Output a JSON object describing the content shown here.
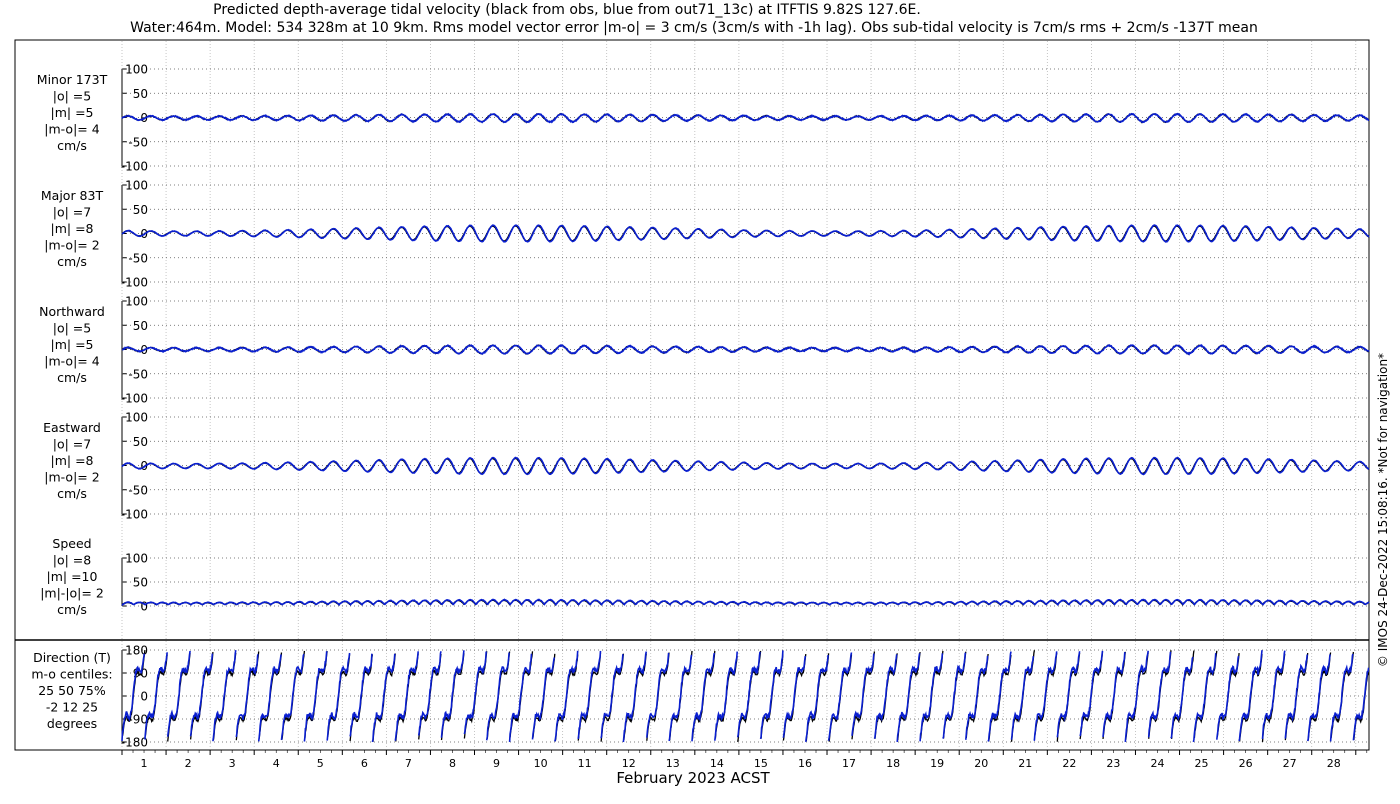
{
  "title_line1": "Predicted depth-average tidal velocity (black from obs, blue from out71_13c) at ITFTIS 9.82S 127.6E.",
  "title_line2": "Water:464m. Model: 534 328m at 10 9km. Rms model vector error |m-o| = 3 cm/s (3cm/s with -1h lag). Obs sub-tidal velocity is 7cm/s rms + 2cm/s -137T mean",
  "copyright_text": "© IMOS 24-Dec-2022 15:08:16.  *Not for navigation*",
  "colors": {
    "obs": "#000000",
    "model": "#0a1fd0",
    "grid": "#888888",
    "axis": "#000000"
  },
  "chart_data": {
    "type": "line",
    "xlabel": "February 2023 ACST",
    "x_ticks": [
      "1",
      "2",
      "3",
      "4",
      "5",
      "6",
      "7",
      "8",
      "9",
      "10",
      "11",
      "12",
      "13",
      "14",
      "15",
      "16",
      "17",
      "18",
      "19",
      "20",
      "21",
      "22",
      "23",
      "24",
      "25",
      "26",
      "27",
      "28"
    ],
    "xlim_days": [
      0.0,
      28.3
    ],
    "series": [
      {
        "name": "obs"
      },
      {
        "name": "model"
      }
    ],
    "panels": [
      {
        "id": "minor",
        "label_lines": [
          "Minor 173T",
          "|o| =5",
          "|m| =5",
          "|m-o|= 4",
          "cm/s"
        ],
        "ylim": [
          -100,
          100
        ],
        "y_ticks": [
          "100",
          "50",
          "0",
          "-50",
          "-100"
        ],
        "y_tick_values": [
          100,
          50,
          0,
          -50,
          -100
        ],
        "signal": {
          "kind": "tide",
          "amp_obs": 6,
          "amp_model": 6,
          "mod_depth": 0.35,
          "bias": -1,
          "noise": 2
        }
      },
      {
        "id": "major",
        "label_lines": [
          "Major 83T",
          "|o| =7",
          "|m| =8",
          "|m-o|= 2",
          "cm/s"
        ],
        "ylim": [
          -100,
          100
        ],
        "y_ticks": [
          "100",
          "50",
          "0",
          "-50",
          "-100"
        ],
        "y_tick_values": [
          100,
          50,
          0,
          -50,
          -100
        ],
        "signal": {
          "kind": "tide",
          "amp_obs": 10,
          "amp_model": 11,
          "mod_depth": 0.55,
          "bias": 0,
          "noise": 1
        }
      },
      {
        "id": "northward",
        "label_lines": [
          "Northward",
          "|o| =5",
          "|m| =5",
          "|m-o|= 4",
          "cm/s"
        ],
        "ylim": [
          -100,
          100
        ],
        "y_ticks": [
          "100",
          "50",
          "0",
          "-50",
          "-100"
        ],
        "y_tick_values": [
          100,
          50,
          0,
          -50,
          -100
        ],
        "signal": {
          "kind": "tide",
          "amp_obs": 6,
          "amp_model": 6,
          "mod_depth": 0.4,
          "bias": 0,
          "noise": 2
        }
      },
      {
        "id": "eastward",
        "label_lines": [
          "Eastward",
          "|o| =7",
          "|m| =8",
          "|m-o|= 2",
          "cm/s"
        ],
        "ylim": [
          -100,
          100
        ],
        "y_ticks": [
          "100",
          "50",
          "0",
          "-50",
          "-100"
        ],
        "y_tick_values": [
          100,
          50,
          0,
          -50,
          -100
        ],
        "signal": {
          "kind": "tide",
          "amp_obs": 10,
          "amp_model": 11,
          "mod_depth": 0.55,
          "bias": -1,
          "noise": 1
        }
      },
      {
        "id": "speed",
        "label_lines": [
          "Speed",
          "|o| =8",
          "|m| =10",
          "|m|-|o|= 2",
          "cm/s"
        ],
        "ylim": [
          0,
          100
        ],
        "y_ticks": [
          "100",
          "50",
          "0"
        ],
        "y_tick_values": [
          100,
          50,
          0
        ],
        "signal": {
          "kind": "speed",
          "amp_obs": 8,
          "amp_model": 9,
          "mod_depth": 0.4,
          "bias": 0,
          "noise": 1
        }
      },
      {
        "id": "direction",
        "label_lines": [
          "Direction (T)",
          "m-o centiles:",
          "25  50  75%",
          "-2  12  25",
          "degrees"
        ],
        "ylim": [
          -180,
          180
        ],
        "y_ticks": [
          "180",
          "90",
          "0",
          "-90",
          "-180"
        ],
        "y_tick_values": [
          180,
          90,
          0,
          -90,
          -180
        ],
        "signal": {
          "kind": "direction",
          "amp_obs": 0,
          "amp_model": 0,
          "mod_depth": 0,
          "bias": 0,
          "noise": 0
        }
      }
    ]
  }
}
